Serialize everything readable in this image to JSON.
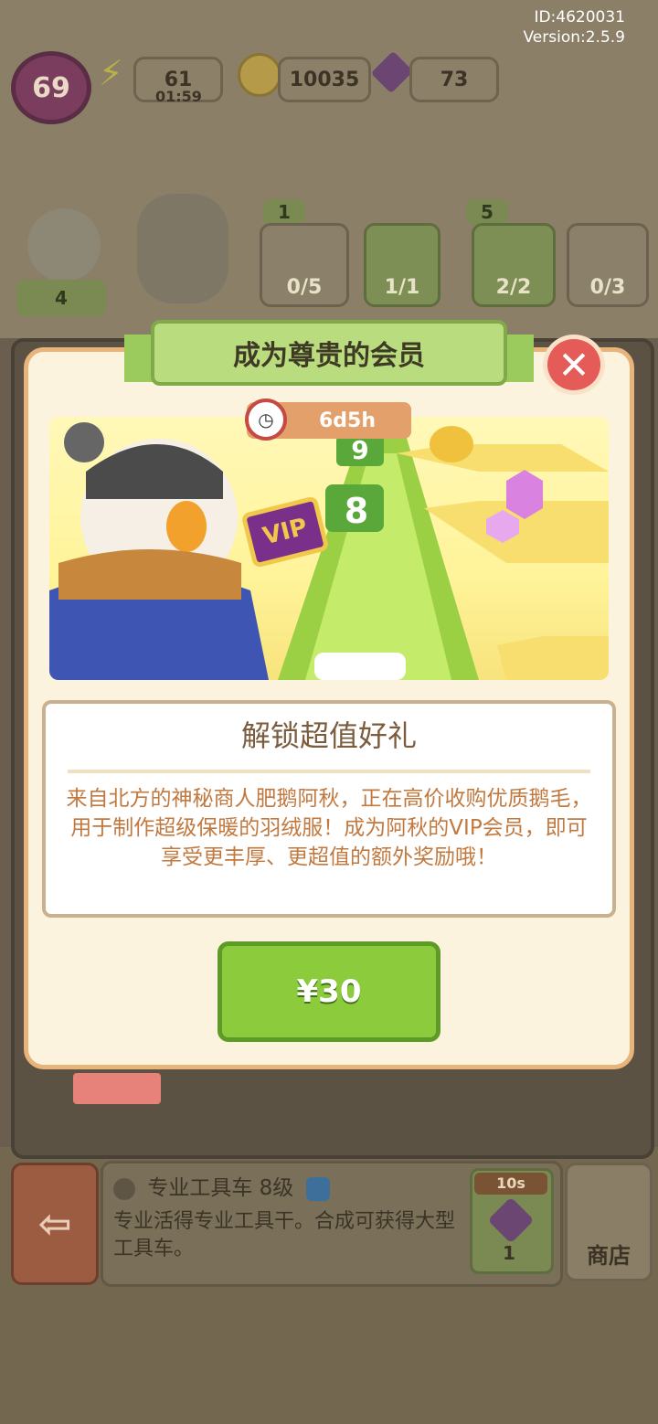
{
  "header": {
    "id_text": "ID:4620031",
    "version_text": "Version:2.5.9",
    "level": "69",
    "energy": {
      "value": "61",
      "timer": "01:59"
    },
    "coins": "10035",
    "gems": "73"
  },
  "board": {
    "left_star_count": "4",
    "slot_groups": [
      {
        "star": "1",
        "slots": [
          {
            "count": "0/5"
          },
          {
            "count": "1/1"
          }
        ]
      },
      {
        "star": "5",
        "slots": [
          {
            "count": "2/2"
          },
          {
            "count": "0/3"
          }
        ]
      }
    ]
  },
  "modal": {
    "title": "成为尊贵的会员",
    "timer": "6d5h",
    "vip_sign": "VIP",
    "step_labels": [
      "9",
      "8"
    ],
    "section_title": "解锁超值好礼",
    "description": "来自北方的神秘商人肥鹅阿秋，正在高价收购优质鹅毛，用于制作超级保暖的羽绒服！成为阿秋的VIP会员，即可享受更丰厚、更超值的额外奖励哦！",
    "price_label": "¥30"
  },
  "bottom_panel": {
    "item_title": "专业工具车 8级",
    "item_desc": "专业活得专业工具干。合成可获得大型工具车。",
    "timer": "10s",
    "gem_count": "1",
    "shop_label": "商店"
  },
  "colors": {
    "accent_green": "#8ccb3c",
    "modal_bg": "#fbf3de",
    "close_red": "#e45b57",
    "desc_text": "#c2793f"
  }
}
